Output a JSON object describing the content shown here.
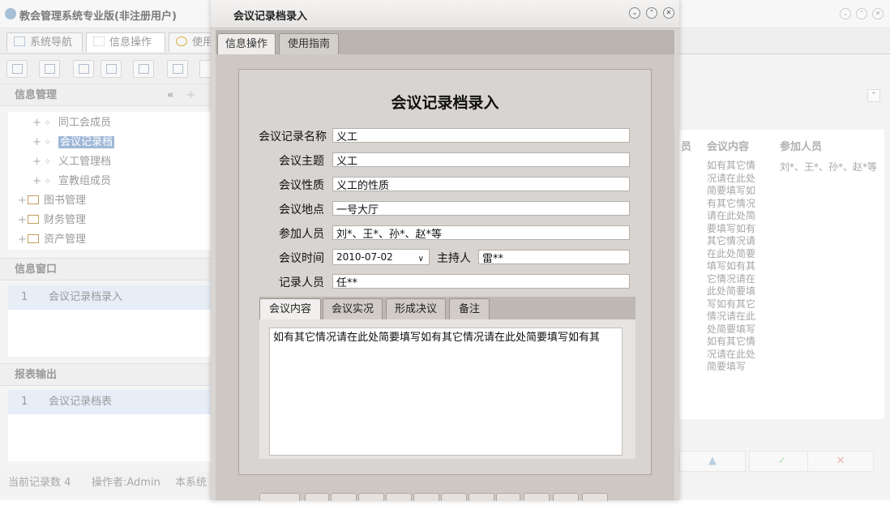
{
  "main": {
    "title": "教会管理系统专业版(非注册用户)",
    "tabs": [
      {
        "label": "系统导航"
      },
      {
        "label": "信息操作"
      },
      {
        "label": "使用"
      }
    ],
    "info_panel": {
      "title": "信息管理",
      "collapse_icon": "«",
      "tree": [
        {
          "label": "同工会成员",
          "selected": false
        },
        {
          "label": "会议记录档",
          "selected": true
        },
        {
          "label": "义工管理档",
          "selected": false
        },
        {
          "label": "宣教组成员",
          "selected": false
        },
        {
          "label": "图书管理",
          "folder": true
        },
        {
          "label": "财务管理",
          "folder": true
        },
        {
          "label": "资产管理",
          "folder": true
        }
      ]
    },
    "window_panel": {
      "title": "信息窗口",
      "rows": [
        {
          "index": "1",
          "label": "会议记录档录入"
        }
      ]
    },
    "report_panel": {
      "title": "报表输出",
      "rows": [
        {
          "index": "1",
          "label": "会议记录档表"
        }
      ]
    },
    "status": {
      "record_count": "当前记录数 4",
      "operator": "操作者:Admin",
      "system": "本系统"
    },
    "grid": {
      "columns": [
        "员",
        "会议内容",
        "参加人员"
      ],
      "row": {
        "content": "如有其它情况请在此处简要填写如有其它情况请在此处简要填写如有其它情况请在此处简要填写如有其它情况请在此处简要填写如有其它情况请在此处简要填写如有其它情况请在此处简要填写",
        "participants": "刘*、王*、孙*、赵*等"
      }
    }
  },
  "dialog": {
    "title": "会议记录档录入",
    "tabs": [
      {
        "label": "信息操作"
      },
      {
        "label": "使用指南"
      }
    ],
    "form": {
      "heading": "会议记录档录入",
      "name_label": "会议记录名称",
      "name_value": "义工",
      "topic_label": "会议主题",
      "topic_value": "义工",
      "nature_label": "会议性质",
      "nature_value": "义工的性质",
      "location_label": "会议地点",
      "location_value": "一号大厅",
      "participants_label": "参加人员",
      "participants_value": "刘*、王*、孙*、赵*等",
      "time_label": "会议时间",
      "time_value": "2010-07-02",
      "host_label": "主持人",
      "host_value": "雷**",
      "recorder_label": "记录人员",
      "recorder_value": "任**"
    },
    "inner_tabs": [
      {
        "label": "会议内容"
      },
      {
        "label": "会议实况"
      },
      {
        "label": "形成决议"
      },
      {
        "label": "备注"
      }
    ],
    "content_text": "如有其它情况请在此处简要填写如有其它情况请在此处简要填写如有其"
  }
}
